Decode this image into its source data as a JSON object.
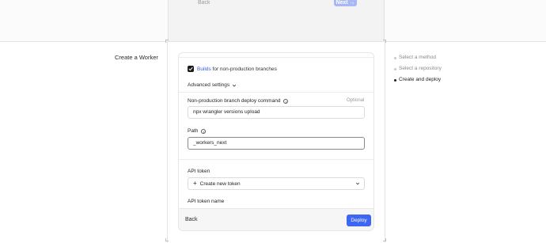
{
  "top_panel": {
    "back_label": "Back",
    "next_label": "Next →"
  },
  "page_title": "Create a Worker",
  "builds": {
    "link_text": "Builds",
    "text": " for non-production branches",
    "checked": true
  },
  "advanced_settings_label": "Advanced settings",
  "deploy_command": {
    "label": "Non-production branch deploy command",
    "optional_label": "Optional",
    "value": "npx wrangler versions upload"
  },
  "path": {
    "label": "Path",
    "value": "_workers_next"
  },
  "api_token": {
    "label": "API token",
    "select_value": "Create new token"
  },
  "api_token_name": {
    "label": "API token name"
  },
  "footer": {
    "back_label": "Back",
    "deploy_label": "Deploy"
  },
  "steps": [
    {
      "label": "Select a method",
      "active": false
    },
    {
      "label": "Select a repository",
      "active": false
    },
    {
      "label": "Create and deploy",
      "active": true
    }
  ],
  "colors": {
    "accent": "#3d67f2",
    "link": "#2f5fe0"
  },
  "icons": [
    "check-icon",
    "chevron-down-icon",
    "info-icon",
    "plus-icon"
  ]
}
